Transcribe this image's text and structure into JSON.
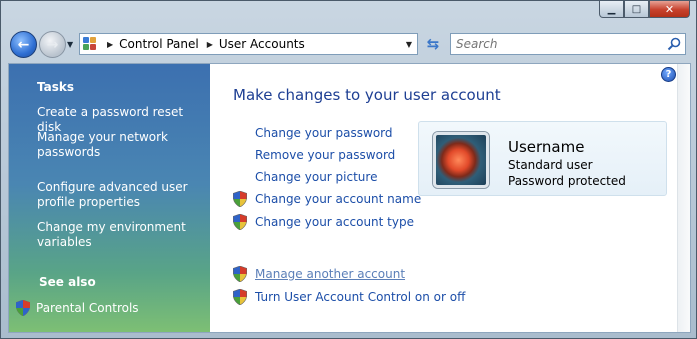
{
  "window": {
    "caption_min": "▁",
    "caption_max": "□",
    "caption_close": "✕"
  },
  "nav": {
    "back_icon": "back-arrow-icon",
    "forward_icon": "forward-arrow-icon",
    "breadcrumb": [
      "Control Panel",
      "User Accounts"
    ],
    "search_placeholder": "Search"
  },
  "sidebar": {
    "tasks_heading": "Tasks",
    "tasks": [
      "Create a password reset disk",
      "Manage your network passwords",
      "Configure advanced user profile properties",
      "Change my environment variables"
    ],
    "see_also_heading": "See also",
    "see_also": [
      "Parental Controls"
    ]
  },
  "main": {
    "title": "Make changes to your user account",
    "links": [
      {
        "label": "Change your password",
        "shield": false
      },
      {
        "label": "Remove your password",
        "shield": false
      },
      {
        "label": "Change your picture",
        "shield": false
      },
      {
        "label": "Change your account name",
        "shield": true
      },
      {
        "label": "Change your account type",
        "shield": true
      }
    ],
    "other_links": [
      {
        "label": "Manage another account",
        "shield": true
      },
      {
        "label": "Turn User Account Control on or off",
        "shield": true
      }
    ]
  },
  "user": {
    "name": "Username",
    "type": "Standard user",
    "status": "Password protected"
  },
  "help_label": "?"
}
